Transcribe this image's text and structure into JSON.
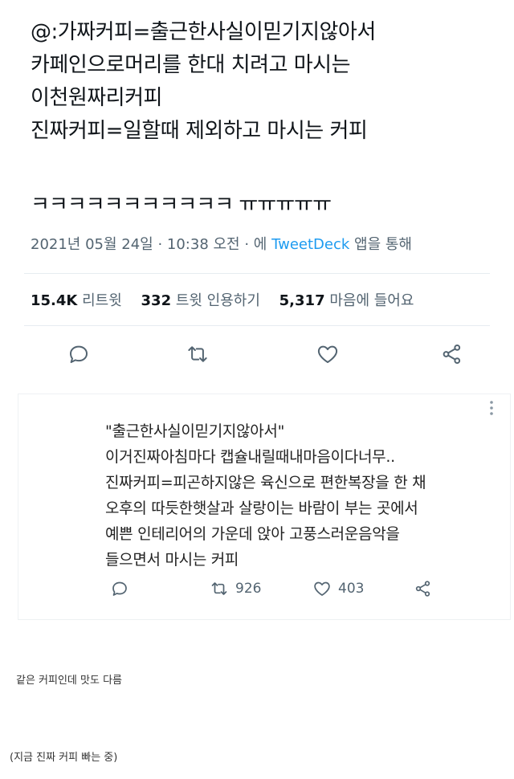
{
  "tweet": {
    "lines": [
      "@:가짜커피=출근한사실이믿기지않아서",
      "카페인으로머리를 한대 치려고 마시는",
      "이천원짜리커피",
      "진짜커피=일할때 제외하고 마시는 커피"
    ],
    "laugh": "ㅋㅋㅋㅋㅋㅋㅋㅋㅋㅋㅋ ㅠㅠㅠㅠㅠ",
    "timestamp": "2021년 05월 24일 · 10:38 오전 · 에",
    "client": "TweetDeck",
    "client_suffix": "앱을 통해",
    "stats": {
      "retweets": "15.4K",
      "retweets_label": "리트윗",
      "quotes": "332",
      "quotes_label": "트윗 인용하기",
      "likes": "5,317",
      "likes_label": "마음에 들어요"
    },
    "actions": [
      "reply-icon",
      "retweet-icon",
      "like-icon",
      "share-icon"
    ]
  },
  "reply": {
    "lines": [
      "\"출근한사실이믿기지않아서\"",
      "이거진짜아침마다 캡슐내릴때내마음이다너무..",
      "진짜커피=피곤하지않은 육신으로 편한복장을 한 채",
      "오후의 따듯한햇살과 살랑이는 바람이 부는 곳에서",
      "예쁜 인테리어의 가운데 앉아 고풍스러운음악을",
      "들으면서 마시는 커피"
    ],
    "retweet_count": "926",
    "like_count": "403"
  },
  "captions": {
    "first": "같은 커피인데 맛도 다름",
    "second": "(지금 진짜 커피 빠는 중)"
  },
  "colors": {
    "text": "#0f1419",
    "muted": "#536471",
    "link": "#1d9bf0",
    "divider": "#e6ecf0"
  }
}
